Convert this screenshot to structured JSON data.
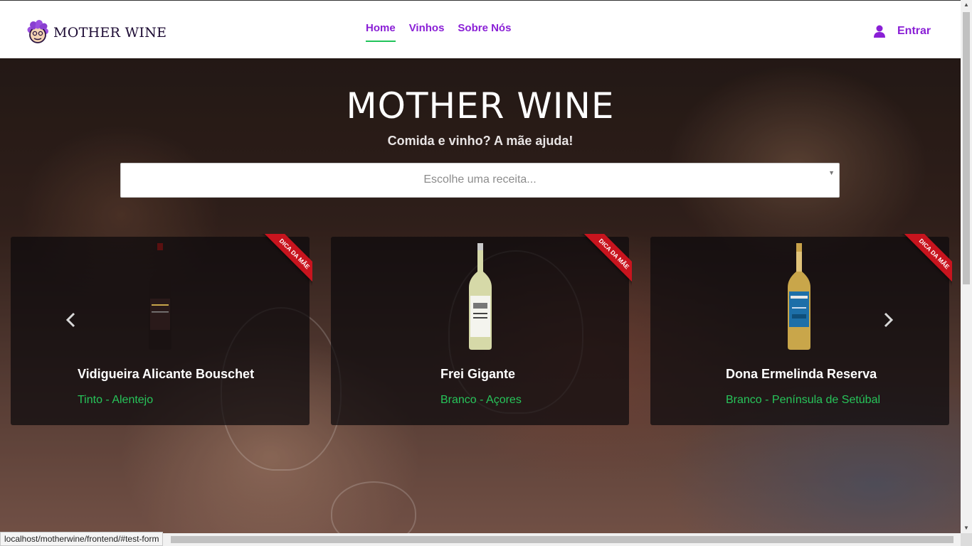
{
  "brand": {
    "name": "MOTHER WINE",
    "logo_icon": "grape-mother-icon"
  },
  "nav": {
    "items": [
      {
        "label": "Home",
        "active": true
      },
      {
        "label": "Vinhos"
      },
      {
        "label": "Sobre Nós"
      }
    ]
  },
  "login": {
    "label": "Entrar",
    "icon": "user-icon"
  },
  "hero": {
    "title": "MOTHER WINE",
    "subtitle": "Comida e vinho? A mãe ajuda!",
    "search": {
      "placeholder": "Escolhe uma receita..."
    }
  },
  "carousel": {
    "prev_icon": "chevron-left-icon",
    "next_icon": "chevron-right-icon",
    "cards": [
      {
        "name": "Vidigueira Alicante Bouschet",
        "region": "Tinto - Alentejo",
        "badge": "DICA DA MÃE",
        "bottle_color": "#1a1212",
        "label_color": "#2a1a1a"
      },
      {
        "name": "Frei Gigante",
        "region": "Branco - Açores",
        "badge": "DICA DA MÃE",
        "bottle_color": "#d6d9a8",
        "label_color": "#f4f4ee"
      },
      {
        "name": "Dona Ermelinda Reserva",
        "region": "Branco - Península de Setúbal",
        "badge": "DICA DA MÃE",
        "bottle_color": "#c9a64a",
        "label_color": "#1d6fa8"
      }
    ]
  },
  "colors": {
    "accent": "#8a1fd6",
    "active_underline": "#21c45a",
    "region_green": "#27c45a",
    "ribbon_red": "#c8141e"
  },
  "statusbar": {
    "url": "localhost/motherwine/frontend/#test-form"
  }
}
